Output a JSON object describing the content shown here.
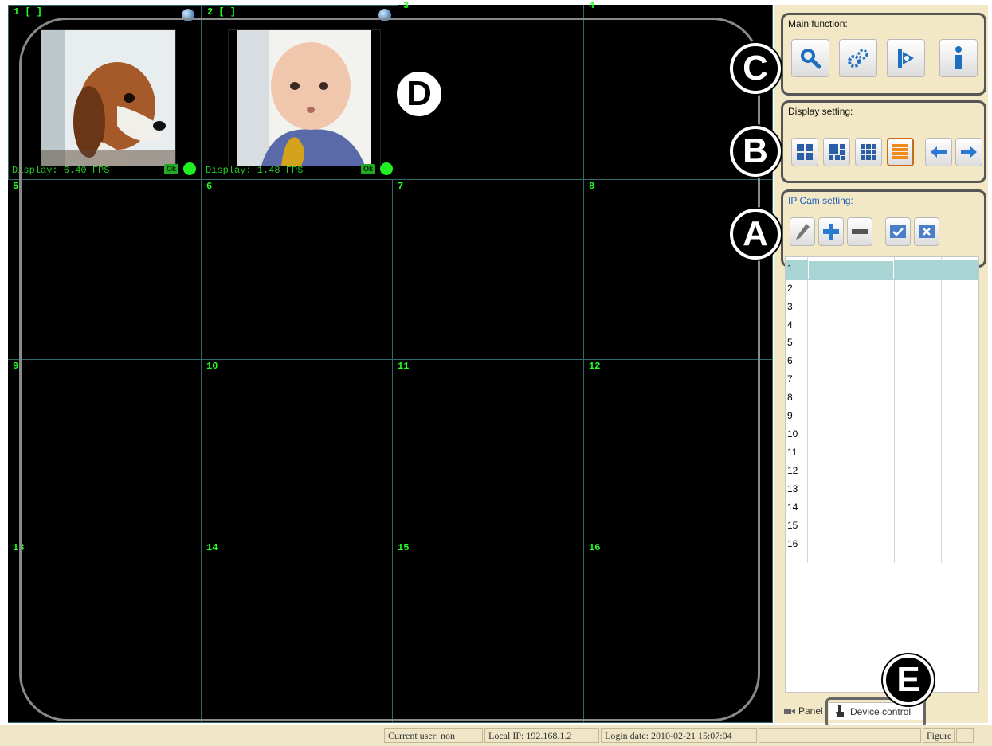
{
  "grid": {
    "cells": [
      {
        "num": "1 [ ]",
        "fps": "Display: 6.40 FPS",
        "image": "beagle-dog-photo",
        "has_video": true
      },
      {
        "num": "2 [ ]",
        "fps": "Display: 1.48 FPS",
        "image": "baby-photo",
        "has_video": true
      },
      {
        "num": "3"
      },
      {
        "num": "4"
      },
      {
        "num": "5"
      },
      {
        "num": "6"
      },
      {
        "num": "7"
      },
      {
        "num": "8"
      },
      {
        "num": "9"
      },
      {
        "num": "10"
      },
      {
        "num": "11"
      },
      {
        "num": "12"
      },
      {
        "num": "13"
      },
      {
        "num": "14"
      },
      {
        "num": "15"
      },
      {
        "num": "16"
      }
    ],
    "ok_label": "Ok"
  },
  "callouts": {
    "a": "A",
    "b": "B",
    "c": "C",
    "d": "D",
    "e": "E"
  },
  "main_function": {
    "title": "Main function:",
    "buttons": [
      {
        "name": "search-button",
        "icon": "search-icon"
      },
      {
        "name": "settings-button",
        "icon": "gears-icon"
      },
      {
        "name": "playback-button",
        "icon": "play-icon"
      },
      {
        "name": "info-button",
        "icon": "info-icon"
      }
    ]
  },
  "display_setting": {
    "title": "Display setting:",
    "buttons": [
      {
        "name": "layout-1-button",
        "icon": "single-view-icon"
      },
      {
        "name": "layout-4-button",
        "icon": "quad-view-icon"
      },
      {
        "name": "layout-9-button",
        "icon": "nine-view-icon"
      },
      {
        "name": "layout-16-button",
        "icon": "sixteen-view-icon",
        "selected": true
      },
      {
        "name": "prev-page-button",
        "icon": "arrow-left-icon"
      },
      {
        "name": "next-page-button",
        "icon": "arrow-right-icon"
      }
    ]
  },
  "ipcam_setting": {
    "title": "IP Cam setting:",
    "buttons": [
      {
        "name": "edit-camera-button",
        "icon": "pencil-icon"
      },
      {
        "name": "add-camera-button",
        "icon": "plus-icon"
      },
      {
        "name": "remove-camera-button",
        "icon": "minus-icon"
      },
      {
        "name": "connect-camera-button",
        "icon": "check-icon"
      },
      {
        "name": "disconnect-camera-button",
        "icon": "x-icon"
      }
    ]
  },
  "camlist": {
    "rows": [
      "1",
      "2",
      "3",
      "4",
      "5",
      "6",
      "7",
      "8",
      "9",
      "10",
      "11",
      "12",
      "13",
      "14",
      "15",
      "16"
    ],
    "selected_index": 0
  },
  "tabs": {
    "panel": "Panel",
    "device_control": "Device control"
  },
  "status": {
    "current_user": "Current user: non",
    "local_ip": "Local IP: 192.168.1.2",
    "login_date": "Login date: 2010-02-21 15:07:04",
    "figure": "Figure"
  },
  "colors": {
    "panel_bg": "#f3e8c5",
    "grid_line": "#2f6a6a",
    "label_green": "#22ff22",
    "selected_row": "#a8d4d4"
  }
}
